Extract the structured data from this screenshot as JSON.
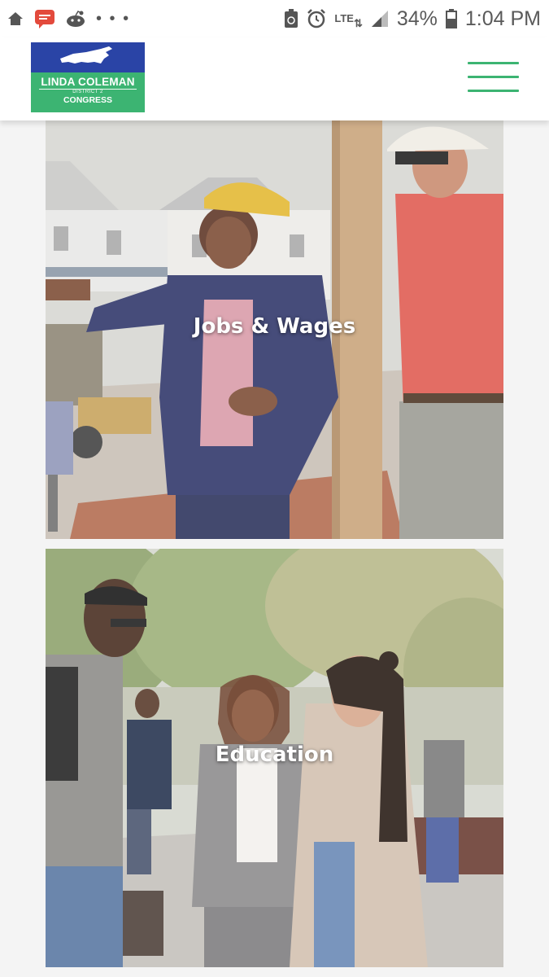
{
  "status_bar": {
    "battery": "34%",
    "time": "1:04 PM",
    "network": "LTE",
    "icons": [
      "home-icon",
      "message-icon",
      "reddit-icon",
      "more-dots-icon",
      "recycle-icon",
      "alarm-icon",
      "lte-icon",
      "signal-icon",
      "battery-icon"
    ]
  },
  "header": {
    "logo": {
      "name": "LINDA COLEMAN",
      "district": "DISTRICT 2",
      "office": "CONGRESS"
    },
    "menu_icon": "hamburger-menu-icon"
  },
  "cards": [
    {
      "title": "Jobs & Wages"
    },
    {
      "title": "Education"
    }
  ],
  "colors": {
    "brand_green": "#3cb472",
    "brand_blue": "#2a44a6"
  }
}
